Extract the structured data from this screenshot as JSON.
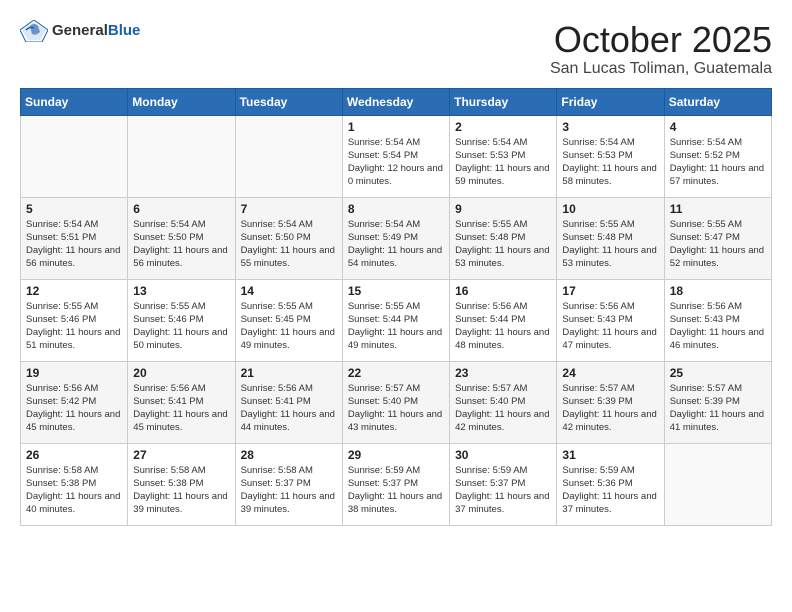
{
  "header": {
    "logo": {
      "general": "General",
      "blue": "Blue"
    },
    "title": "October 2025",
    "location": "San Lucas Toliman, Guatemala"
  },
  "weekdays": [
    "Sunday",
    "Monday",
    "Tuesday",
    "Wednesday",
    "Thursday",
    "Friday",
    "Saturday"
  ],
  "weeks": [
    [
      {
        "day": "",
        "sunrise": "",
        "sunset": "",
        "daylight": ""
      },
      {
        "day": "",
        "sunrise": "",
        "sunset": "",
        "daylight": ""
      },
      {
        "day": "",
        "sunrise": "",
        "sunset": "",
        "daylight": ""
      },
      {
        "day": "1",
        "sunrise": "Sunrise: 5:54 AM",
        "sunset": "Sunset: 5:54 PM",
        "daylight": "Daylight: 12 hours and 0 minutes."
      },
      {
        "day": "2",
        "sunrise": "Sunrise: 5:54 AM",
        "sunset": "Sunset: 5:53 PM",
        "daylight": "Daylight: 11 hours and 59 minutes."
      },
      {
        "day": "3",
        "sunrise": "Sunrise: 5:54 AM",
        "sunset": "Sunset: 5:53 PM",
        "daylight": "Daylight: 11 hours and 58 minutes."
      },
      {
        "day": "4",
        "sunrise": "Sunrise: 5:54 AM",
        "sunset": "Sunset: 5:52 PM",
        "daylight": "Daylight: 11 hours and 57 minutes."
      }
    ],
    [
      {
        "day": "5",
        "sunrise": "Sunrise: 5:54 AM",
        "sunset": "Sunset: 5:51 PM",
        "daylight": "Daylight: 11 hours and 56 minutes."
      },
      {
        "day": "6",
        "sunrise": "Sunrise: 5:54 AM",
        "sunset": "Sunset: 5:50 PM",
        "daylight": "Daylight: 11 hours and 56 minutes."
      },
      {
        "day": "7",
        "sunrise": "Sunrise: 5:54 AM",
        "sunset": "Sunset: 5:50 PM",
        "daylight": "Daylight: 11 hours and 55 minutes."
      },
      {
        "day": "8",
        "sunrise": "Sunrise: 5:54 AM",
        "sunset": "Sunset: 5:49 PM",
        "daylight": "Daylight: 11 hours and 54 minutes."
      },
      {
        "day": "9",
        "sunrise": "Sunrise: 5:55 AM",
        "sunset": "Sunset: 5:48 PM",
        "daylight": "Daylight: 11 hours and 53 minutes."
      },
      {
        "day": "10",
        "sunrise": "Sunrise: 5:55 AM",
        "sunset": "Sunset: 5:48 PM",
        "daylight": "Daylight: 11 hours and 53 minutes."
      },
      {
        "day": "11",
        "sunrise": "Sunrise: 5:55 AM",
        "sunset": "Sunset: 5:47 PM",
        "daylight": "Daylight: 11 hours and 52 minutes."
      }
    ],
    [
      {
        "day": "12",
        "sunrise": "Sunrise: 5:55 AM",
        "sunset": "Sunset: 5:46 PM",
        "daylight": "Daylight: 11 hours and 51 minutes."
      },
      {
        "day": "13",
        "sunrise": "Sunrise: 5:55 AM",
        "sunset": "Sunset: 5:46 PM",
        "daylight": "Daylight: 11 hours and 50 minutes."
      },
      {
        "day": "14",
        "sunrise": "Sunrise: 5:55 AM",
        "sunset": "Sunset: 5:45 PM",
        "daylight": "Daylight: 11 hours and 49 minutes."
      },
      {
        "day": "15",
        "sunrise": "Sunrise: 5:55 AM",
        "sunset": "Sunset: 5:44 PM",
        "daylight": "Daylight: 11 hours and 49 minutes."
      },
      {
        "day": "16",
        "sunrise": "Sunrise: 5:56 AM",
        "sunset": "Sunset: 5:44 PM",
        "daylight": "Daylight: 11 hours and 48 minutes."
      },
      {
        "day": "17",
        "sunrise": "Sunrise: 5:56 AM",
        "sunset": "Sunset: 5:43 PM",
        "daylight": "Daylight: 11 hours and 47 minutes."
      },
      {
        "day": "18",
        "sunrise": "Sunrise: 5:56 AM",
        "sunset": "Sunset: 5:43 PM",
        "daylight": "Daylight: 11 hours and 46 minutes."
      }
    ],
    [
      {
        "day": "19",
        "sunrise": "Sunrise: 5:56 AM",
        "sunset": "Sunset: 5:42 PM",
        "daylight": "Daylight: 11 hours and 45 minutes."
      },
      {
        "day": "20",
        "sunrise": "Sunrise: 5:56 AM",
        "sunset": "Sunset: 5:41 PM",
        "daylight": "Daylight: 11 hours and 45 minutes."
      },
      {
        "day": "21",
        "sunrise": "Sunrise: 5:56 AM",
        "sunset": "Sunset: 5:41 PM",
        "daylight": "Daylight: 11 hours and 44 minutes."
      },
      {
        "day": "22",
        "sunrise": "Sunrise: 5:57 AM",
        "sunset": "Sunset: 5:40 PM",
        "daylight": "Daylight: 11 hours and 43 minutes."
      },
      {
        "day": "23",
        "sunrise": "Sunrise: 5:57 AM",
        "sunset": "Sunset: 5:40 PM",
        "daylight": "Daylight: 11 hours and 42 minutes."
      },
      {
        "day": "24",
        "sunrise": "Sunrise: 5:57 AM",
        "sunset": "Sunset: 5:39 PM",
        "daylight": "Daylight: 11 hours and 42 minutes."
      },
      {
        "day": "25",
        "sunrise": "Sunrise: 5:57 AM",
        "sunset": "Sunset: 5:39 PM",
        "daylight": "Daylight: 11 hours and 41 minutes."
      }
    ],
    [
      {
        "day": "26",
        "sunrise": "Sunrise: 5:58 AM",
        "sunset": "Sunset: 5:38 PM",
        "daylight": "Daylight: 11 hours and 40 minutes."
      },
      {
        "day": "27",
        "sunrise": "Sunrise: 5:58 AM",
        "sunset": "Sunset: 5:38 PM",
        "daylight": "Daylight: 11 hours and 39 minutes."
      },
      {
        "day": "28",
        "sunrise": "Sunrise: 5:58 AM",
        "sunset": "Sunset: 5:37 PM",
        "daylight": "Daylight: 11 hours and 39 minutes."
      },
      {
        "day": "29",
        "sunrise": "Sunrise: 5:59 AM",
        "sunset": "Sunset: 5:37 PM",
        "daylight": "Daylight: 11 hours and 38 minutes."
      },
      {
        "day": "30",
        "sunrise": "Sunrise: 5:59 AM",
        "sunset": "Sunset: 5:37 PM",
        "daylight": "Daylight: 11 hours and 37 minutes."
      },
      {
        "day": "31",
        "sunrise": "Sunrise: 5:59 AM",
        "sunset": "Sunset: 5:36 PM",
        "daylight": "Daylight: 11 hours and 37 minutes."
      },
      {
        "day": "",
        "sunrise": "",
        "sunset": "",
        "daylight": ""
      }
    ]
  ]
}
